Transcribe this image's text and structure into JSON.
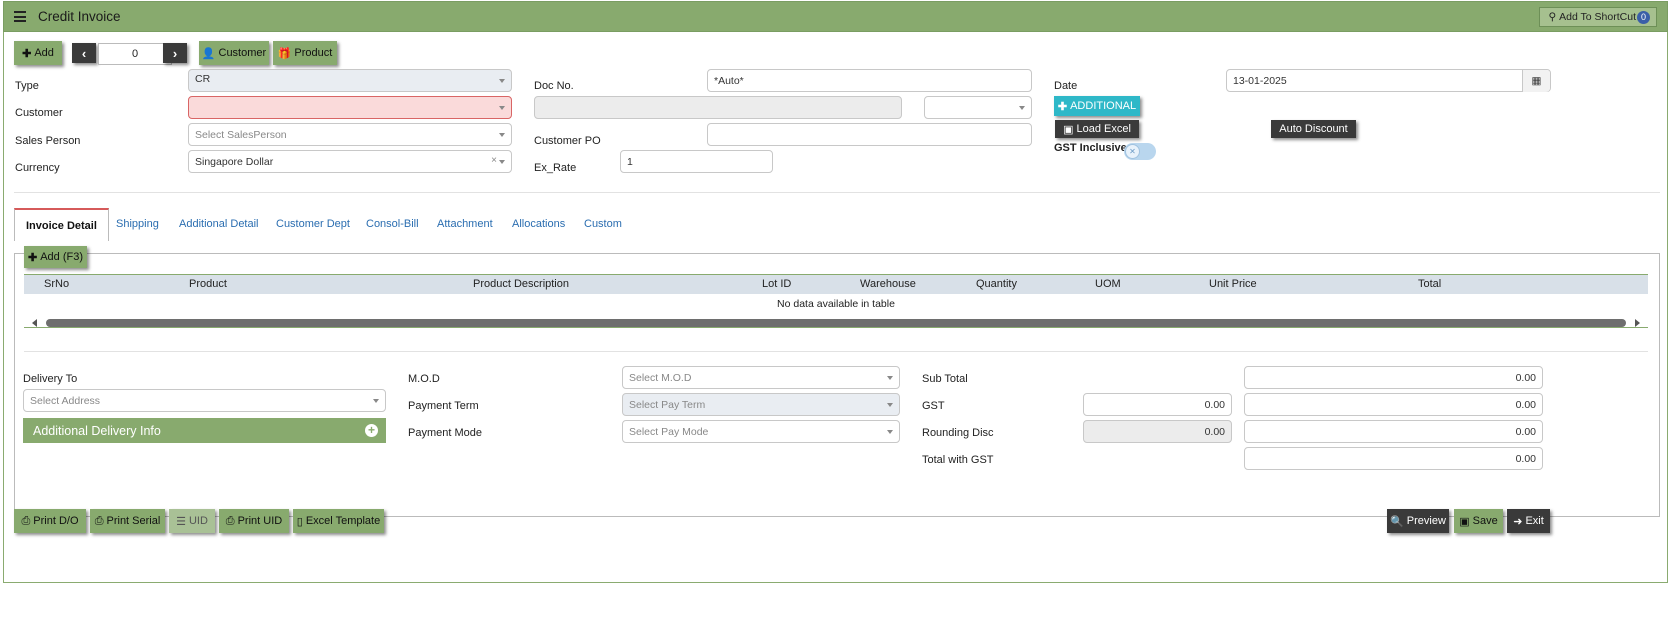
{
  "header": {
    "title": "Credit Invoice",
    "shortcut_label": "Add To ShortCut",
    "shortcut_count": "0"
  },
  "toolbar": {
    "add": "Add",
    "nav_value": "0",
    "customer": "Customer",
    "product": "Product"
  },
  "form": {
    "type_label": "Type",
    "type_value": "CR",
    "customer_label": "Customer",
    "salesperson_label": "Sales Person",
    "salesperson_placeholder": "Select SalesPerson",
    "currency_label": "Currency",
    "currency_value": "Singapore Dollar",
    "docno_label": "Doc No.",
    "docno_value": "*Auto*",
    "custpo_label": "Customer PO",
    "exrate_label": "Ex_Rate",
    "exrate_value": "1",
    "date_label": "Date",
    "date_value": "13-01-2025",
    "additional_btn": "ADDITIONAL",
    "load_excel_btn": "Load Excel",
    "auto_discount_btn": "Auto Discount",
    "gst_inclusive_label": "GST Inclusive"
  },
  "tabs": [
    "Invoice Detail",
    "Shipping",
    "Additional Detail",
    "Customer Dept",
    "Consol-Bill",
    "Attachment",
    "Allocations",
    "Custom"
  ],
  "grid": {
    "add_label": "Add (F3)",
    "columns": [
      "SrNo",
      "Product",
      "Product Description",
      "Lot ID",
      "Warehouse",
      "Quantity",
      "UOM",
      "Unit Price",
      "Total"
    ],
    "empty_text": "No data available in table"
  },
  "footer_form": {
    "delivery_label": "Delivery To",
    "delivery_placeholder": "Select Address",
    "delivery_info": "Additional Delivery Info",
    "mod_label": "M.O.D",
    "mod_placeholder": "Select M.O.D",
    "payterm_label": "Payment Term",
    "payterm_placeholder": "Select Pay Term",
    "paymode_label": "Payment Mode",
    "paymode_placeholder": "Select Pay Mode",
    "subtotal_label": "Sub Total",
    "subtotal_value": "0.00",
    "gst_label": "GST",
    "gst_rate": "0.00",
    "gst_value": "0.00",
    "rounding_label": "Rounding Disc",
    "rounding_rate": "0.00",
    "rounding_value": "0.00",
    "total_label": "Total with GST",
    "total_value": "0.00"
  },
  "bottom_buttons": {
    "print_do": "Print D/O",
    "print_serial": "Print Serial",
    "uid": "UID",
    "print_uid": "Print UID",
    "excel_template": "Excel Template",
    "preview": "Preview",
    "save": "Save",
    "exit": "Exit"
  },
  "colors": {
    "accent_green": "#88aa6e",
    "dark_button": "#3a3a3a",
    "teal_button": "#2eb8c8",
    "link_blue": "#2a6db0",
    "error_red": "#d96565"
  }
}
